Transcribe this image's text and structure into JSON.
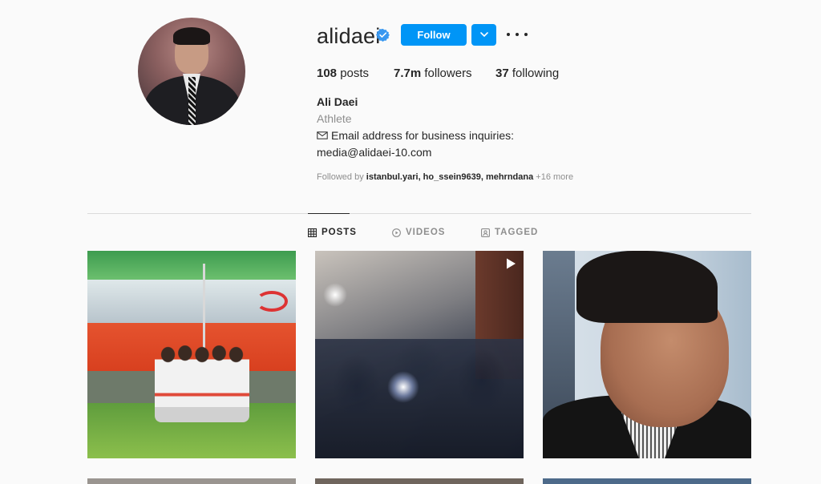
{
  "profile": {
    "username": "alidaei",
    "follow_label": "Follow",
    "stats": {
      "posts_count": "108",
      "posts_label": "posts",
      "followers_count": "7.7m",
      "followers_label": "followers",
      "following_count": "37",
      "following_label": "following"
    },
    "bio": {
      "name": "Ali Daei",
      "category": "Athlete",
      "line1": "Email address for business inquiries:",
      "line2": "media@alidaei-10.com"
    },
    "followed_by": {
      "prefix": "Followed by",
      "names": "istanbul.yari, ho_ssein9639, mehrndana",
      "more": "+16 more"
    }
  },
  "tabs": [
    {
      "label": "POSTS",
      "icon": "grid-icon",
      "active": true
    },
    {
      "label": "VIDEOS",
      "icon": "play-circle-icon",
      "active": false
    },
    {
      "label": "TAGGED",
      "icon": "tag-person-icon",
      "active": false
    }
  ],
  "colors": {
    "accent": "#0095f6",
    "text": "#262626",
    "muted": "#8e8e8e",
    "background": "#fafafa"
  }
}
